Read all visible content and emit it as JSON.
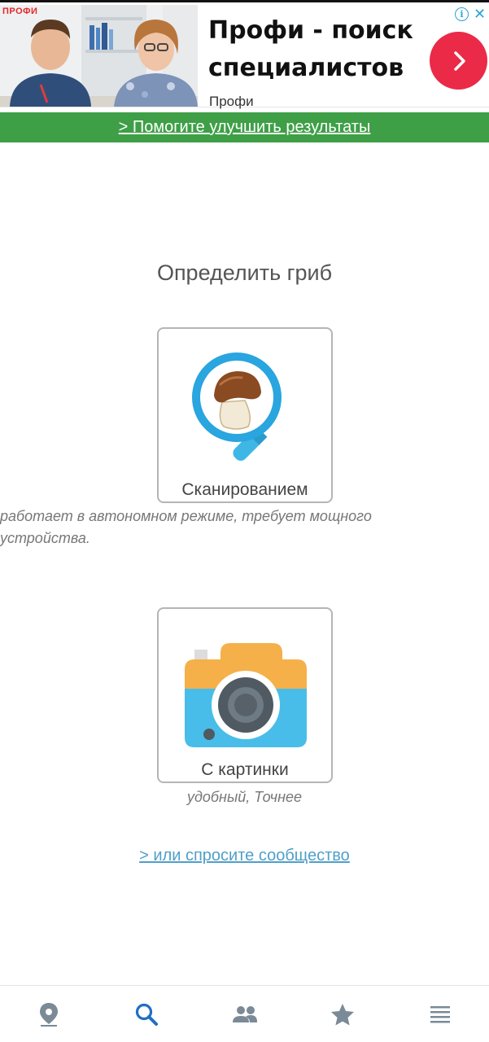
{
  "ad": {
    "brand": "ПРОФИ",
    "title": "Профи - поиск специалистов",
    "source": "Профи",
    "info_glyph": "i",
    "close_glyph": "✕",
    "accent_color": "#ea2a47"
  },
  "feedback": {
    "text": "> Помогите улучшить результаты",
    "background_color": "#3e9f47"
  },
  "main": {
    "title": "Определить гриб",
    "options": [
      {
        "label": "Сканированием",
        "description": "работает в автономном режиме, требует мощного устройства.",
        "icon": "mushroom-magnifier-icon"
      },
      {
        "label": "С картинки",
        "description": "удобный, Точнее",
        "icon": "camera-icon"
      }
    ],
    "community_link": "> или спросите сообщество"
  },
  "bottom_nav": {
    "items": [
      {
        "icon": "map-pin-icon",
        "active": false
      },
      {
        "icon": "search-icon",
        "active": true
      },
      {
        "icon": "community-icon",
        "active": false
      },
      {
        "icon": "star-icon",
        "active": false
      },
      {
        "icon": "menu-icon",
        "active": false
      }
    ],
    "active_color": "#1e6fc4",
    "inactive_color": "#7a8a96"
  }
}
